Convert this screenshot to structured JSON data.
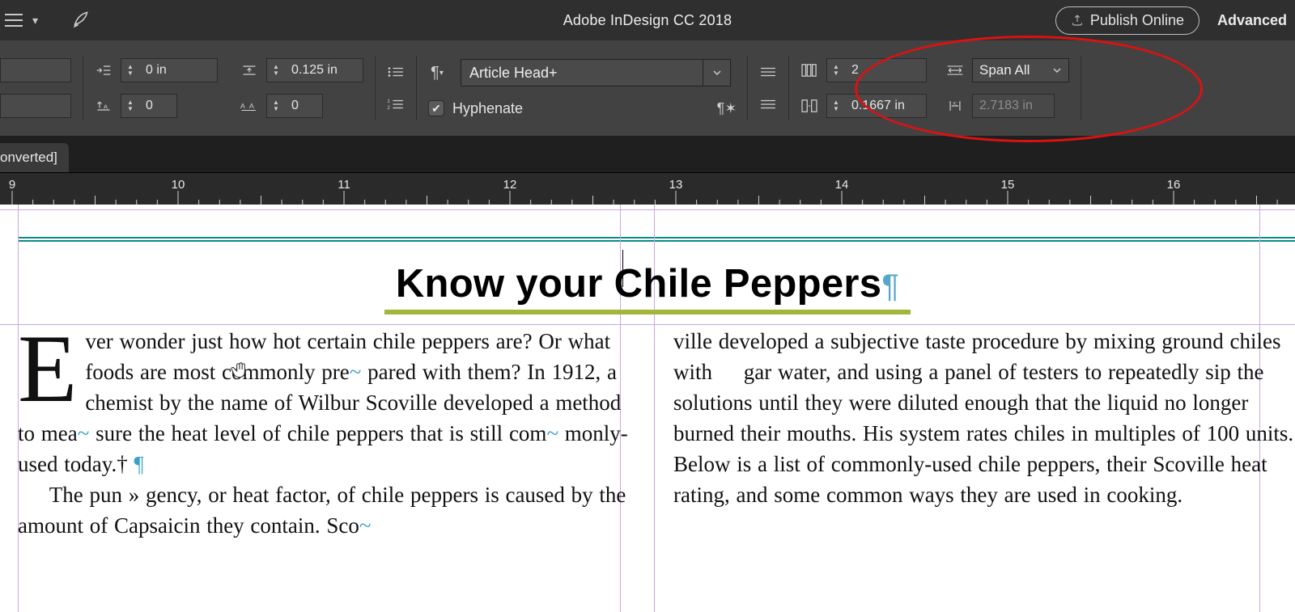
{
  "app": {
    "title": "Adobe InDesign CC 2018"
  },
  "menubar": {
    "publish_label": "Publish Online",
    "workspace_label": "Advanced"
  },
  "controlbar": {
    "indent_left": "0 in",
    "space_before": "0.125 in",
    "baseline_shift": "0",
    "tracking": "0",
    "paragraph_style": "Article Head+",
    "hyphenate_label": "Hyphenate",
    "hyphenate_checked": true,
    "columns_count": "2",
    "column_gutter": "0.1667 in",
    "span_label": "Span All",
    "span_width": "2.7183 in"
  },
  "doc_tab": {
    "label": "onverted]"
  },
  "ruler": {
    "marks": [
      9,
      10,
      11,
      12,
      13,
      14,
      15,
      16
    ]
  },
  "document": {
    "heading": "Know your Chile Peppers",
    "col1_html": "<span class='dropcap'>E</span>ver wonder just how hot certain chile peppers are? Or what foods are most commonly pre<span class='eol'>~</span> pared with them? In 1912, a chemist by the name of Wilbur Scoville developed a method to mea<span class='eol'>~</span> sure the heat level of chile peppers that is still com<span class='eol'>~</span> monly-used today.&#8224; <span class='eol'>&para;</span><br>&nbsp;&nbsp;&nbsp;&nbsp;&nbsp;The pun&nbsp;&raquo;&nbsp;gency, or heat factor, of chile peppers is caused by the amount of Capsaicin they contain. Sco<span class='eol'>~</span>",
    "col2_html": "ville developed a subjective taste procedure by mixing ground chiles with&nbsp;&nbsp;&nbsp;&nbsp;&nbsp;gar water, and using a panel of testers to repeatedly sip the solutions until they were diluted enough that the liquid no longer burned their mouths. His system rates chiles in multiples of 100 units. Below is a list of commonly-used chile peppers, their Scoville heat rating, and some common ways they are used in cooking."
  }
}
